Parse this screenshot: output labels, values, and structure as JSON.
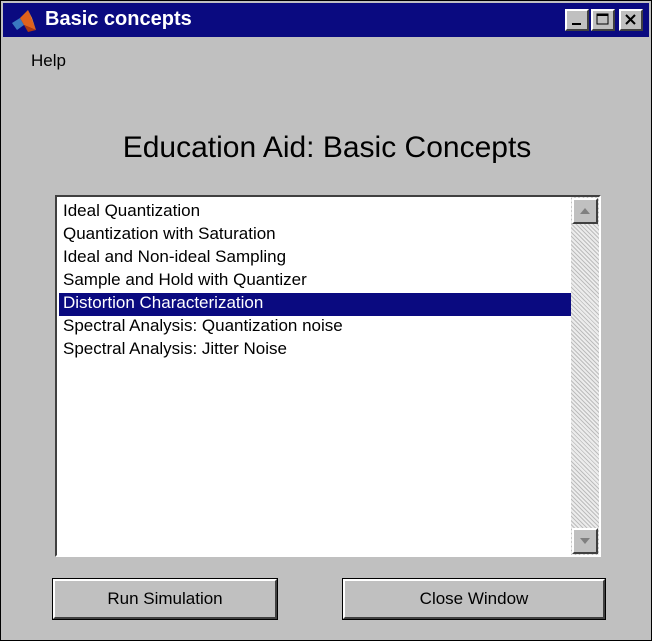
{
  "window": {
    "title": "Basic concepts",
    "title_bar_color": "#0a0a80",
    "background_color": "#c0c0c0"
  },
  "menu": {
    "items": [
      {
        "label": "Help"
      }
    ]
  },
  "main": {
    "heading": "Education Aid: Basic Concepts"
  },
  "listbox": {
    "items": [
      {
        "label": "Ideal Quantization",
        "selected": false
      },
      {
        "label": "Quantization with Saturation",
        "selected": false
      },
      {
        "label": "Ideal and Non-ideal Sampling",
        "selected": false
      },
      {
        "label": "Sample and Hold with Quantizer",
        "selected": false
      },
      {
        "label": "Distortion Characterization",
        "selected": true
      },
      {
        "label": "Spectral Analysis: Quantization noise",
        "selected": false
      },
      {
        "label": "Spectral Analysis: Jitter Noise",
        "selected": false
      }
    ],
    "selection_color": "#0a0a80"
  },
  "buttons": {
    "run_label": "Run Simulation",
    "close_label": "Close Window"
  },
  "icons": {
    "app": "matlab-logo-icon",
    "minimize": "minimize-icon",
    "maximize": "maximize-icon",
    "close": "close-icon",
    "scroll_up": "arrow-up-icon",
    "scroll_down": "arrow-down-icon"
  }
}
